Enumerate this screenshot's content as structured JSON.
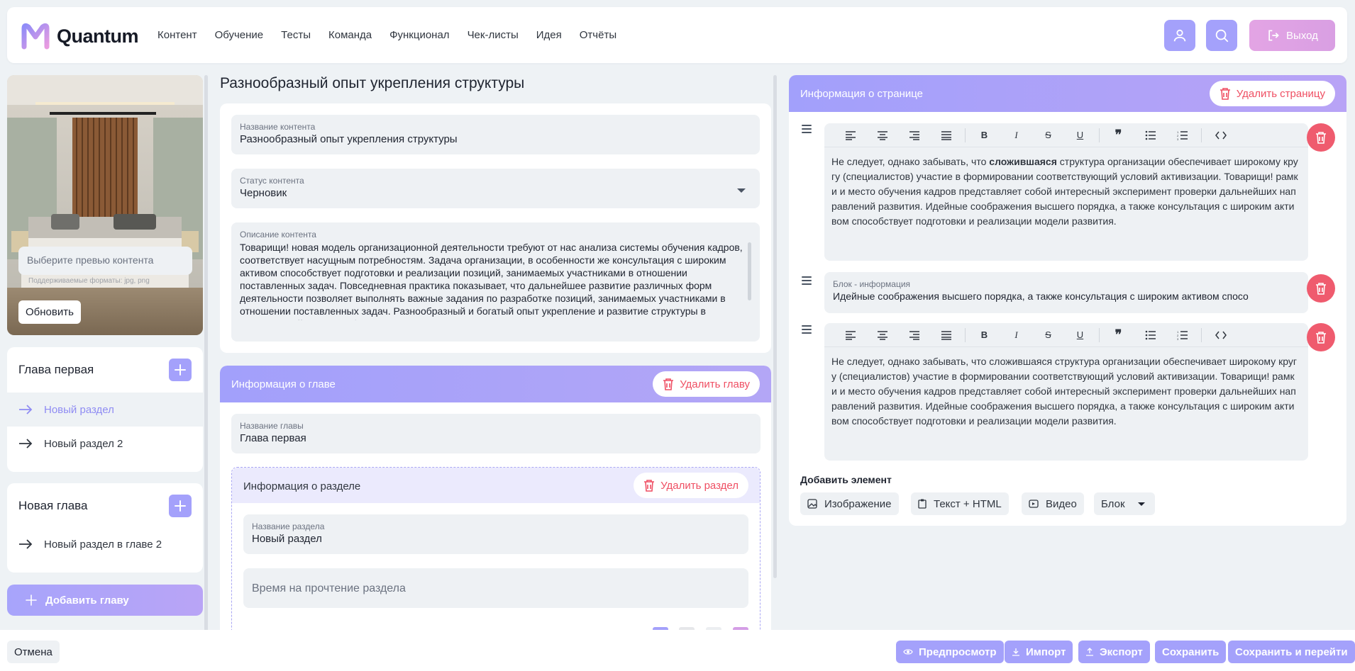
{
  "app": {
    "name": "Quantum"
  },
  "nav": [
    "Контент",
    "Обучение",
    "Тесты",
    "Команда",
    "Функционал",
    "Чек-листы",
    "Идея",
    "Отчёты"
  ],
  "header": {
    "logout_label": "Выход",
    "user_icon": "user-icon",
    "search_icon": "search-icon"
  },
  "preview": {
    "placeholder": "Выберите превью контента",
    "hint": "Поддерживаемые форматы: jpg, png",
    "update_label": "Обновить"
  },
  "chapters": [
    {
      "title": "Глава первая",
      "sections": [
        "Новый раздел",
        "Новый раздел 2"
      ],
      "active_section": 0
    },
    {
      "title": "Новая глава",
      "sections": [
        "Новый раздел в главе 2"
      ]
    }
  ],
  "add_chapter_label": "Добавить главу",
  "content": {
    "page_title": "Разнообразный опыт укрепления структуры",
    "name_label": "Название контента",
    "name_value": "Разнообразный опыт укрепления структуры",
    "status_label": "Статус контента",
    "status_value": "Черновик",
    "desc_label": "Описание контента",
    "desc_value": "Товарищи! новая модель организационной деятельности требуют от нас анализа системы обучения кадров, соответствует насущным потребностям. Задача организации, в особенности же консультация с широким активом способствует подготовки и реализации позиций, занимаемых участниками в отношении поставленных задач. Повседневная практика показывает, что дальнейшее развитие различных форм деятельности позволяет выполнять важные задания по разработке позиций, занимаемых участниками в отношении поставленных задач. Разнообразный и богатый опыт укрепление и развитие структуры в значительной степени обуславливает создание"
  },
  "chapter_info": {
    "header": "Информация о главе",
    "delete_label": "Удалить главу",
    "name_label": "Название главы",
    "name_value": "Глава первая"
  },
  "section_info": {
    "header": "Информация о разделе",
    "delete_label": "Удалить раздел",
    "name_label": "Название раздела",
    "name_value": "Новый раздел",
    "time_placeholder": "Время на прочтение раздела"
  },
  "page_info": {
    "header": "Информация о странице",
    "delete_label": "Удалить страницу",
    "editor1": {
      "pre": "Не следует, однако забывать, что ",
      "bold": "сложившаяся",
      "post": " структура организации обеспечивает широкому кругу (специалистов) участие в формировании соответствующий условий активизации. Товарищи! рамки и место обучения кадров представляет собой интересный эксперимент проверки дальнейших направлений развития. Идейные соображения высшего порядка, а также консультация с широким активом способствует подготовки и реализации модели развития."
    },
    "block": {
      "label": "Блок - информация",
      "value": "Идейные соображения высшего порядка, а также консультация с широким активом спосо"
    },
    "editor2": {
      "text": "Не следует, однако забывать, что сложившаяся структура организации обеспечивает широкому кругу (специалистов) участие в формировании соответствующий условий активизации. Товарищи! рамки и место обучения кадров представляет собой интересный эксперимент проверки дальнейших направлений развития. Идейные соображения высшего порядка, а также консультация с широким активом способствует подготовки и реализации модели развития."
    },
    "add_element_title": "Добавить элемент",
    "add_buttons": [
      "Изображение",
      "Текст + HTML",
      "Видео",
      "Блок"
    ]
  },
  "bottom": {
    "cancel": "Отмена",
    "preview": "Предпросмотр",
    "import": "Импорт",
    "export": "Экспорт",
    "save": "Сохранить",
    "save_go": "Сохранить и перейти"
  },
  "colors": {
    "accent": "#a4a1fb",
    "danger": "#ef5b6e",
    "logout": "#dfa3e4"
  }
}
